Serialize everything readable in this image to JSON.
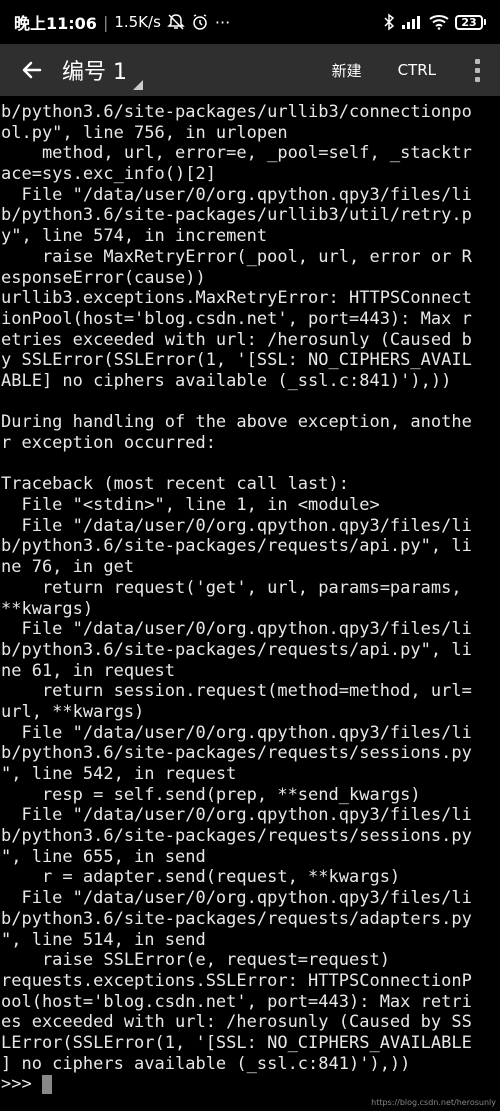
{
  "status_bar": {
    "time": "晚上11:06",
    "speed": "1.5K/s",
    "battery": "23"
  },
  "toolbar": {
    "title": "编号 1",
    "new_label": "新建",
    "ctrl_label": "CTRL"
  },
  "terminal": {
    "lines": [
      "b/python3.6/site-packages/urllib3/connectionpo",
      "ol.py\", line 756, in urlopen",
      "    method, url, error=e, _pool=self, _stacktr",
      "ace=sys.exc_info()[2]",
      "  File \"/data/user/0/org.qpython.qpy3/files/li",
      "b/python3.6/site-packages/urllib3/util/retry.p",
      "y\", line 574, in increment",
      "    raise MaxRetryError(_pool, url, error or R",
      "esponseError(cause))",
      "urllib3.exceptions.MaxRetryError: HTTPSConnect",
      "ionPool(host='blog.csdn.net', port=443): Max r",
      "etries exceeded with url: /herosunly (Caused b",
      "y SSLError(SSLError(1, '[SSL: NO_CIPHERS_AVAIL",
      "ABLE] no ciphers available (_ssl.c:841)'),))",
      "",
      "During handling of the above exception, anothe",
      "r exception occurred:",
      "",
      "Traceback (most recent call last):",
      "  File \"<stdin>\", line 1, in <module>",
      "  File \"/data/user/0/org.qpython.qpy3/files/li",
      "b/python3.6/site-packages/requests/api.py\", li",
      "ne 76, in get",
      "    return request('get', url, params=params,",
      "**kwargs)",
      "  File \"/data/user/0/org.qpython.qpy3/files/li",
      "b/python3.6/site-packages/requests/api.py\", li",
      "ne 61, in request",
      "    return session.request(method=method, url=",
      "url, **kwargs)",
      "  File \"/data/user/0/org.qpython.qpy3/files/li",
      "b/python3.6/site-packages/requests/sessions.py",
      "\", line 542, in request",
      "    resp = self.send(prep, **send_kwargs)",
      "  File \"/data/user/0/org.qpython.qpy3/files/li",
      "b/python3.6/site-packages/requests/sessions.py",
      "\", line 655, in send",
      "    r = adapter.send(request, **kwargs)",
      "  File \"/data/user/0/org.qpython.qpy3/files/li",
      "b/python3.6/site-packages/requests/adapters.py",
      "\", line 514, in send",
      "    raise SSLError(e, request=request)",
      "requests.exceptions.SSLError: HTTPSConnectionP",
      "ool(host='blog.csdn.net', port=443): Max retri",
      "es exceeded with url: /herosunly (Caused by SS",
      "LError(SSLError(1, '[SSL: NO_CIPHERS_AVAILABLE",
      "] no ciphers available (_ssl.c:841)'),))"
    ],
    "prompt": ">>> "
  },
  "watermark": "https://blog.csdn.net/herosunly"
}
